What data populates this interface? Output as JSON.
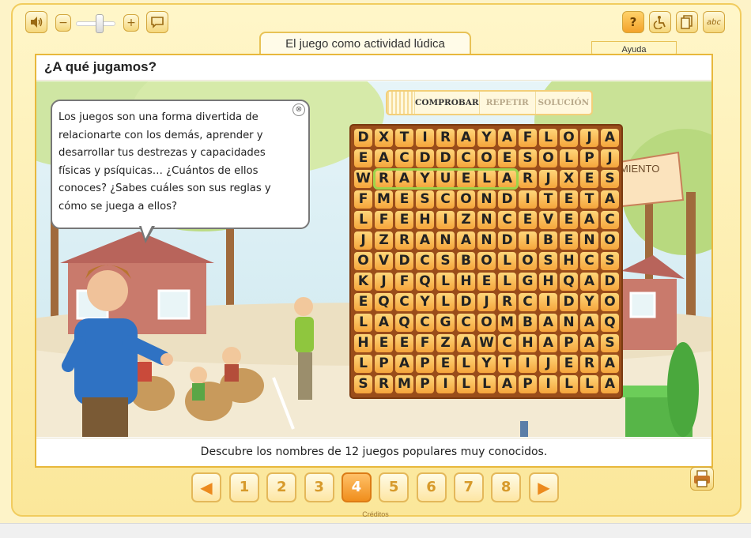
{
  "app": {
    "title": "El juego como actividad lúdica",
    "help_label": "Ayuda",
    "credits_label": "Créditos"
  },
  "toolbar": {
    "sound_icon": "speaker-icon",
    "volume_down": "−",
    "volume_up": "+",
    "volume_level": 0.62,
    "subtitles_icon": "speech-bubble-icon",
    "help_icon_text": "?",
    "accessibility_icon": "wheelchair-icon",
    "copy_icon": "document-icon",
    "glossary_text": "abc"
  },
  "page": {
    "heading": "¿A qué jugamos?",
    "bubble_text": "Los juegos son una forma divertida de relacionarte con los demás, aprender y desarrollar tus destrezas y capacidades físicas y psíquicas… ¿Cuántos de ellos conoces? ¿Sabes cuáles son sus reglas y cómo se juega a ellos?",
    "bubble_lines": [
      "Los juegos son una forma divertida de",
      "relacionarte con los demás, aprender y",
      "desarrollar tus destrezas y capacidades",
      "físicas y psíquicas… ¿Cuántos de ellos",
      "conoces? ¿Sabes cuáles son sus reglas y",
      "cómo se juega a ellos?"
    ],
    "close_glyph": "⊗",
    "sign_text": "MIENTO",
    "instruction": "Descubre los nombres de 12 juegos populares muy conocidos."
  },
  "actions": {
    "check": "COMPROBAR",
    "repeat": "REPETIR",
    "solution": "SOLUCIÓN"
  },
  "word_grid": {
    "rows": [
      "DXTIRAYAFLOJA",
      "EACDDCOESOLPJ",
      "WRAYUELARJXES",
      "FMESCONDITETA",
      "LFEHIZNCEVEAC",
      "JZRANANDIBENO",
      "OVDCSBOLOSHCS",
      "KJFQLHELGHQAD",
      "EQCYLDJRCIDYO",
      "LAQCGCOMBANAQ",
      "HEEFZAWCHAPAS",
      "LPAPELYTIJERA",
      "SRMPILLAPILLA"
    ],
    "found_word": "RAYUELA"
  },
  "navigation": {
    "prev_glyph": "◀",
    "next_glyph": "▶",
    "pages": [
      "1",
      "2",
      "3",
      "4",
      "5",
      "6",
      "7",
      "8"
    ],
    "current_page": "4"
  },
  "colors": {
    "frame": "#fbe79a",
    "accent": "#f08e1c",
    "grid_border": "#9a4d1a",
    "found_highlight": "#9dd44a"
  }
}
